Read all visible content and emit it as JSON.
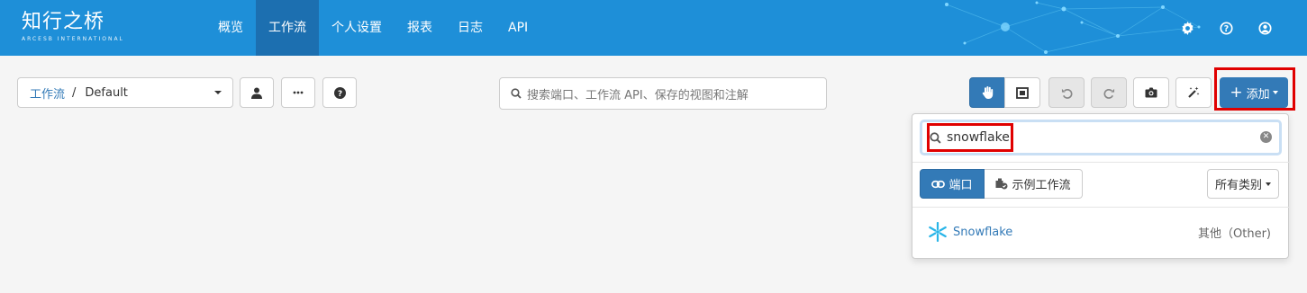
{
  "brand": {
    "name": "知行之桥",
    "tagline": "ARCESB INTERNATIONAL"
  },
  "nav": {
    "items": [
      {
        "label": "概览",
        "active": false
      },
      {
        "label": "工作流",
        "active": true
      },
      {
        "label": "个人设置",
        "active": false
      },
      {
        "label": "报表",
        "active": false
      },
      {
        "label": "日志",
        "active": false
      },
      {
        "label": "API",
        "active": false
      }
    ],
    "icons": [
      "gear-icon",
      "help-icon",
      "user-icon"
    ]
  },
  "toolbar": {
    "breadcrumb": {
      "root": "工作流",
      "separator": "/",
      "current": "Default"
    },
    "search_placeholder": "搜索端口、工作流 API、保存的视图和注解",
    "add_label": "添加"
  },
  "add_panel": {
    "search_value": "snowflake",
    "tabs": [
      {
        "label": "端口",
        "active": true
      },
      {
        "label": "示例工作流",
        "active": false
      }
    ],
    "category_label": "所有类别",
    "results": [
      {
        "name": "Snowflake",
        "category": "其他（Other)",
        "icon": "snowflake-icon"
      }
    ]
  },
  "colors": {
    "navbar": "#1e8fd8",
    "nav_active": "#1c6fb0",
    "primary": "#337ab7",
    "highlight": "#e00000"
  }
}
